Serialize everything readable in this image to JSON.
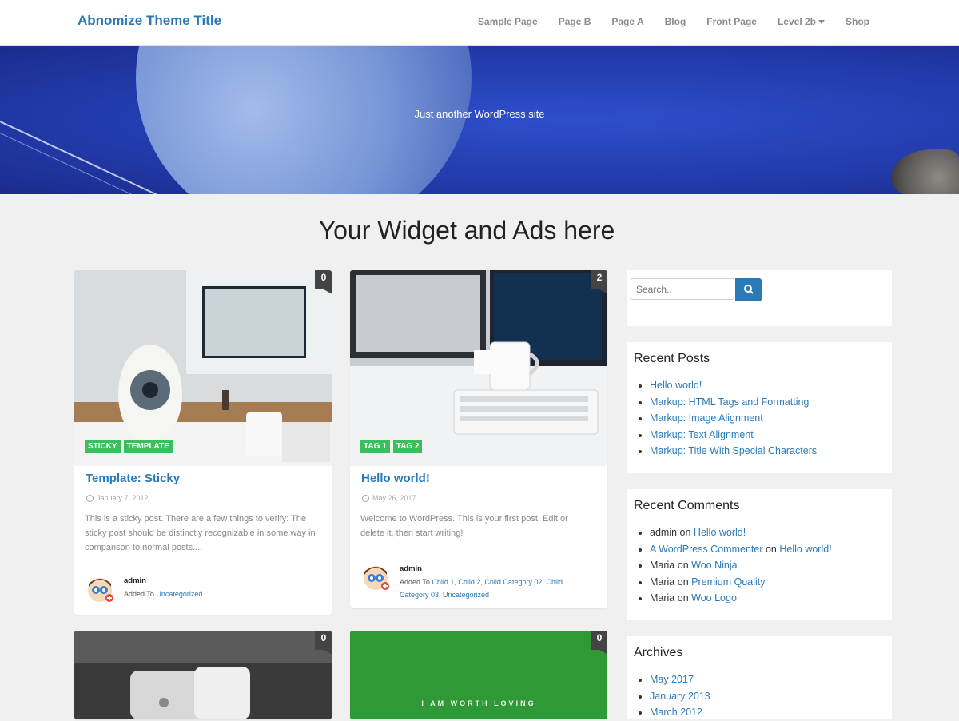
{
  "header": {
    "title": "Abnomize Theme Title",
    "nav": [
      "Sample Page",
      "Page B",
      "Page A",
      "Blog",
      "Front Page",
      "Level 2b",
      "Shop"
    ]
  },
  "hero": {
    "tagline": "Just another WordPress site"
  },
  "widget_banner": "Your Widget and Ads here",
  "posts": [
    {
      "title": "Template: Sticky",
      "date": "January 7, 2012",
      "comments": "0",
      "tags": [
        "STICKY",
        "TEMPLATE"
      ],
      "excerpt": "This is a sticky post. There are a few things to verify: The sticky post should be distinctly recognizable in some way in comparison to normal posts....",
      "author": "admin",
      "added_to_label": "Added To",
      "categories": "Uncategorized"
    },
    {
      "title": "Hello world!",
      "date": "May 26, 2017",
      "comments": "2",
      "tags": [
        "TAG 1",
        "TAG 2"
      ],
      "excerpt": "Welcome to WordPress. This is your first post. Edit or delete it, then start writing!",
      "author": "admin",
      "added_to_label": "Added To",
      "categories": "Child 1, Child 2, Child Category 02, Child Category 03, Uncategorized"
    },
    {
      "comments": "0"
    },
    {
      "comments": "0",
      "image_text": "I AM WORTH LOVING"
    }
  ],
  "sidebar": {
    "search_placeholder": "Search..",
    "recent_posts": {
      "title": "Recent Posts",
      "items": [
        "Hello world!",
        "Markup: HTML Tags and Formatting",
        "Markup: Image Alignment",
        "Markup: Text Alignment",
        "Markup: Title With Special Characters"
      ]
    },
    "recent_comments": {
      "title": "Recent Comments",
      "on_word": "on",
      "items": [
        {
          "author": "admin",
          "post": "Hello world!"
        },
        {
          "author": "A WordPress Commenter",
          "post": "Hello world!"
        },
        {
          "author": "Maria",
          "post": "Woo Ninja"
        },
        {
          "author": "Maria",
          "post": "Premium Quality"
        },
        {
          "author": "Maria",
          "post": "Woo Logo"
        }
      ]
    },
    "archives": {
      "title": "Archives",
      "items": [
        "May 2017",
        "January 2013",
        "March 2012"
      ]
    }
  },
  "colors": {
    "accent": "#2a7ab8",
    "tag": "#3cbf5a",
    "hero": "#233cae",
    "green_card": "#2f9a35"
  }
}
